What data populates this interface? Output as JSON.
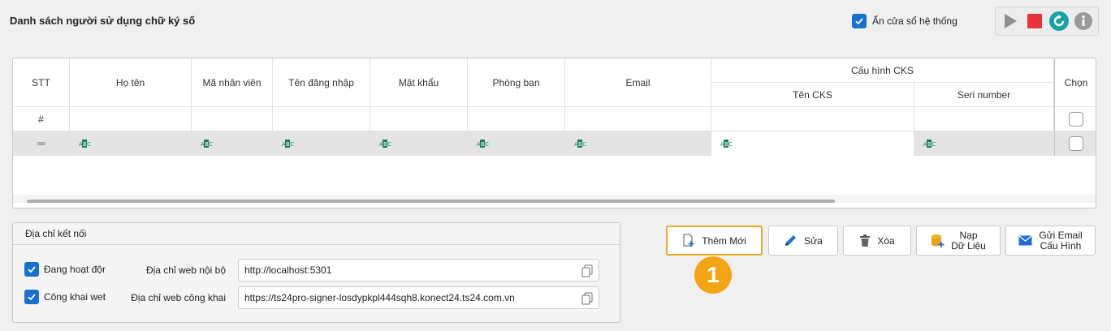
{
  "header": {
    "title": "Danh sách người sử dụng chữ ký số",
    "hide_window_label": "Ẩn cửa sổ hệ thống",
    "hide_window_checked": true
  },
  "grid": {
    "columns": {
      "stt": "STT",
      "ho_ten": "Họ tên",
      "ma_nv": "Mã nhân viên",
      "ten_dn": "Tên đăng nhập",
      "mat_khau": "Mật khẩu",
      "phong_ban": "Phòng ban",
      "email": "Email",
      "cks_group": "Cấu hình CKS",
      "ten_cks": "Tên CKS",
      "seri": "Seri number",
      "chon": "Chọn"
    },
    "filter_row_marker": "#",
    "new_row_marker": "═",
    "abc_label": "ABC"
  },
  "connection": {
    "title": "Địa chỉ kết nối",
    "active_label": "Đang hoạt động",
    "active_checked": true,
    "public_label": "Công khai web",
    "public_checked": true,
    "local_label": "Địa chỉ web nội bộ",
    "local_value": "http://localhost:5301",
    "public_web_label": "Địa chỉ web công khai",
    "public_web_value": "https://ts24pro-signer-losdypkpl444sqh8.konect24.ts24.com.vn"
  },
  "buttons": {
    "add": "Thêm Mới",
    "edit": "Sửa",
    "delete": "Xóa",
    "load_line1": "Nạp",
    "load_line2": "Dữ Liệu",
    "send_line1": "Gửi Email",
    "send_line2": "Cấu Hình"
  },
  "annotation": {
    "step": "1"
  },
  "colors": {
    "accent": "#1a6fcf",
    "highlight_border": "#e7a92a",
    "badge": "#f3a515",
    "stop": "#e8333a",
    "refresh": "#17a3a3"
  }
}
